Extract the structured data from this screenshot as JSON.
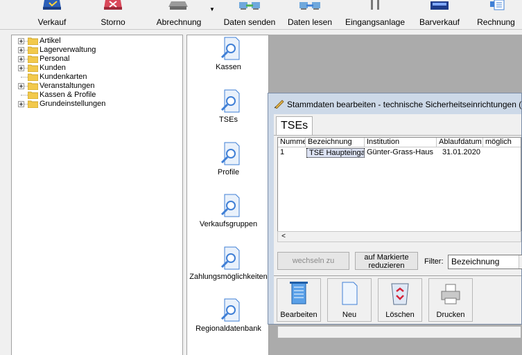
{
  "toolbar": {
    "items": [
      {
        "label": "Verkauf",
        "icon": "sale-icon"
      },
      {
        "label": "Storno",
        "icon": "storno-icon"
      },
      {
        "label": "Abrechnung",
        "icon": "printer-icon"
      },
      {
        "label": "Daten senden",
        "icon": "send-data-icon"
      },
      {
        "label": "Daten lesen",
        "icon": "read-data-icon"
      },
      {
        "label": "Eingangsanlage",
        "icon": "gate-icon"
      },
      {
        "label": "Barverkauf",
        "icon": "cash-register-icon"
      },
      {
        "label": "Rechnung",
        "icon": "invoice-icon"
      }
    ]
  },
  "tree": {
    "items": [
      {
        "label": "Artikel",
        "expandable": true
      },
      {
        "label": "Lagerverwaltung",
        "expandable": true
      },
      {
        "label": "Personal",
        "expandable": true
      },
      {
        "label": "Kunden",
        "expandable": true
      },
      {
        "label": "Kundenkarten",
        "expandable": false
      },
      {
        "label": "Veranstaltungen",
        "expandable": true
      },
      {
        "label": "Kassen & Profile",
        "expandable": false
      },
      {
        "label": "Grundeinstellungen",
        "expandable": true
      }
    ]
  },
  "nav": {
    "items": [
      {
        "label": "Kassen"
      },
      {
        "label": "TSEs"
      },
      {
        "label": "Profile"
      },
      {
        "label": "Verkaufsgruppen"
      },
      {
        "label": "Zahlungsmöglichkeiten"
      },
      {
        "label": "Regionaldatenbank"
      }
    ]
  },
  "dialog": {
    "title": "Stammdaten bearbeiten - technische Sicherheitseinrichtungen (",
    "tab": "TSEs",
    "columns": [
      "Nummer",
      "Bezeichnung",
      "Institution",
      "Ablaufdatum",
      "möglich"
    ],
    "rows": [
      [
        "1",
        "TSE Haupteinga",
        "Günter-Grass-Haus",
        "31.01.2020",
        ""
      ]
    ],
    "wechseln_label": "wechseln zu",
    "reduce_label_1": "auf Markierte",
    "reduce_label_2": "reduzieren",
    "filter_label": "Filter:",
    "filter_value": "Bezeichnung",
    "buttons": [
      {
        "label": "Bearbeiten",
        "icon": "notepad-icon"
      },
      {
        "label": "Neu",
        "icon": "new-document-icon"
      },
      {
        "label": "Löschen",
        "icon": "recycle-bin-icon"
      },
      {
        "label": "Drucken",
        "icon": "printer-icon"
      }
    ]
  },
  "colors": {
    "workspace": "#ababab",
    "dialog_frame": "#cdd9e8",
    "selected_row": "#dde3f4",
    "folder": "#f2c94c"
  }
}
